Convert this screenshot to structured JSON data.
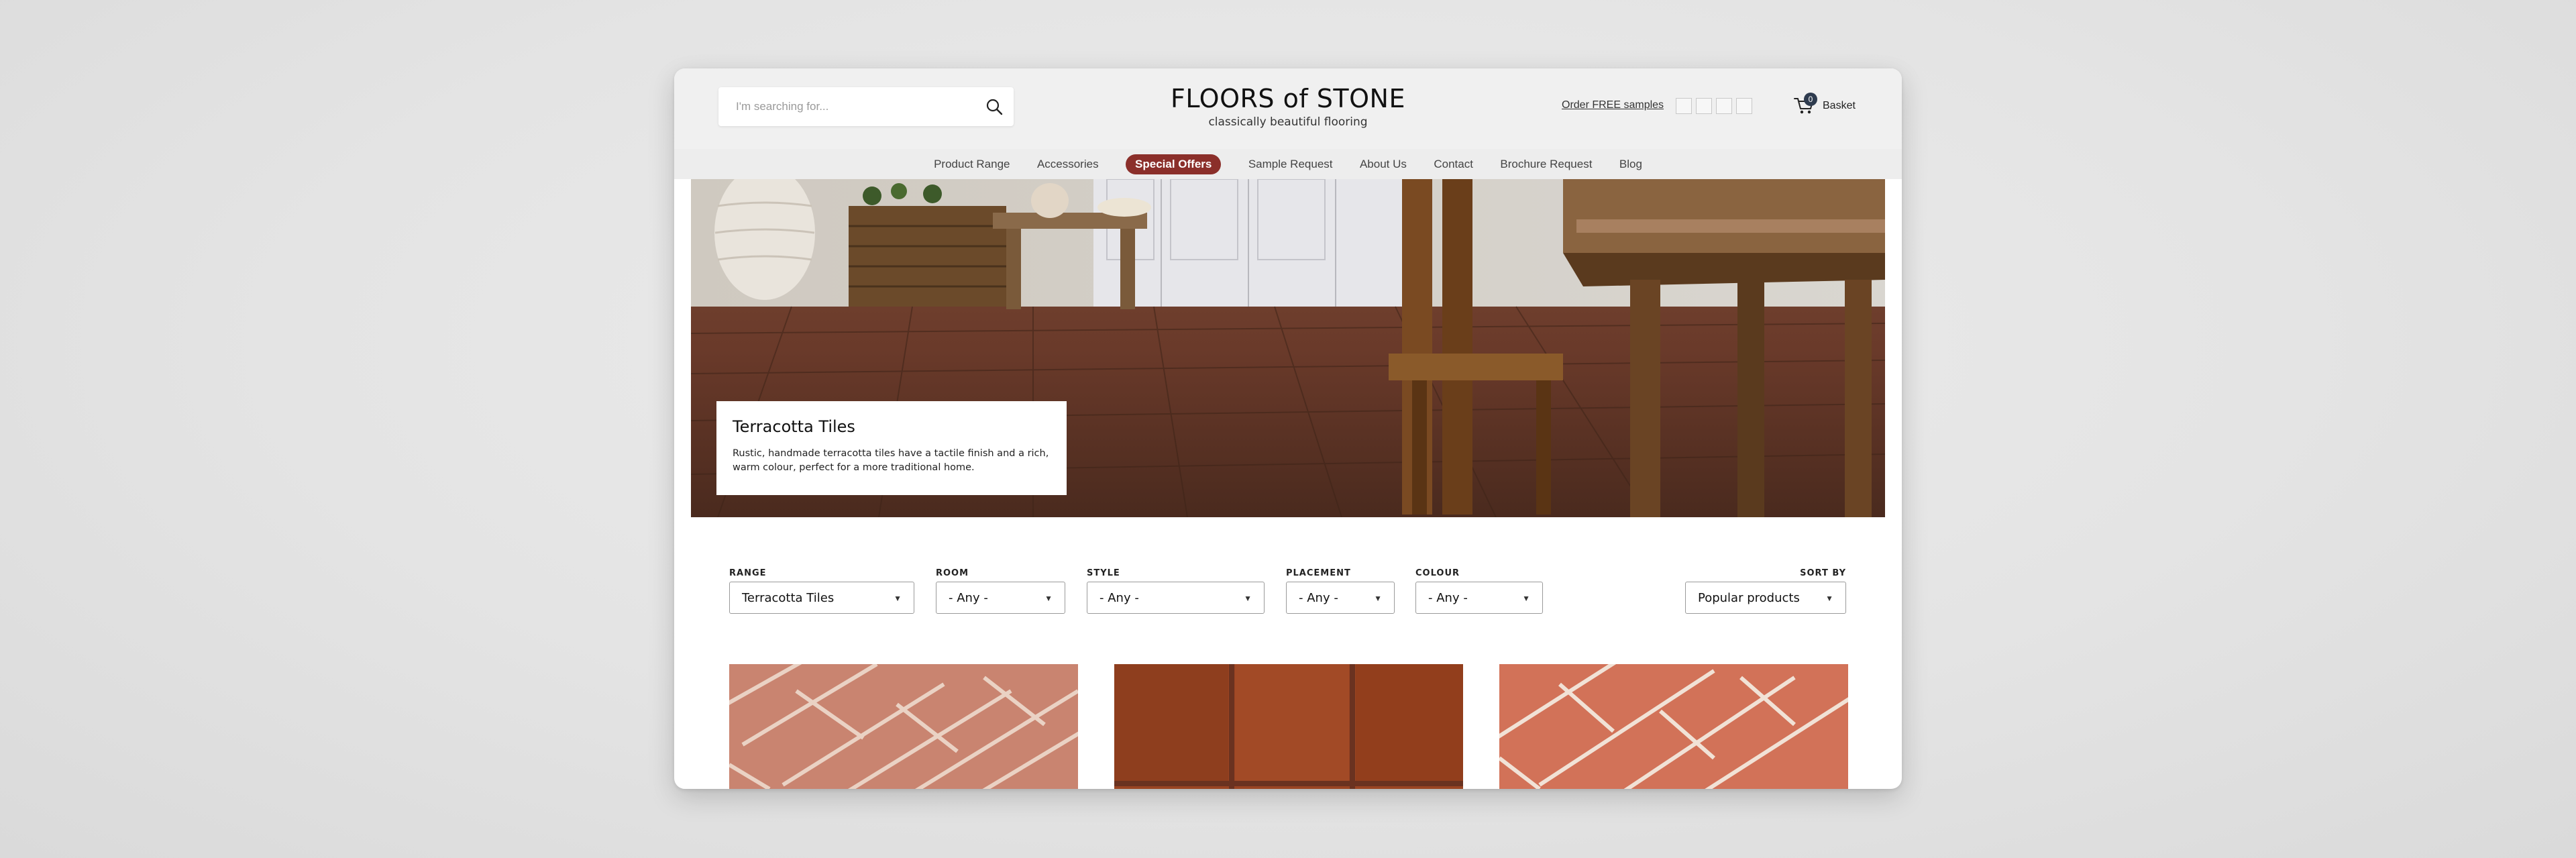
{
  "header": {
    "search_placeholder": "I'm searching for...",
    "logo_title": "FLOORS of STONE",
    "logo_tagline": "classically beautiful flooring",
    "samples_link": "Order FREE samples",
    "basket_count": "0",
    "basket_label": "Basket"
  },
  "nav": {
    "items": [
      "Product Range",
      "Accessories",
      "Special Offers",
      "Sample Request",
      "About Us",
      "Contact",
      "Brochure Request",
      "Blog"
    ]
  },
  "hero": {
    "title": "Terracotta Tiles",
    "description": "Rustic, handmade terracotta tiles have a tactile finish and a rich, warm colour, perfect for a more traditional home."
  },
  "filters": {
    "range": {
      "label": "RANGE",
      "value": "Terracotta Tiles"
    },
    "room": {
      "label": "ROOM",
      "value": "- Any -"
    },
    "style": {
      "label": "STYLE",
      "value": "- Any -"
    },
    "placement": {
      "label": "PLACEMENT",
      "value": "- Any -"
    },
    "colour": {
      "label": "COLOUR",
      "value": "- Any -"
    },
    "sort": {
      "label": "SORT BY",
      "value": "Popular products"
    }
  },
  "colors": {
    "special_offer_bg": "#8b2f2a",
    "basket_badge": "#2e3b4e",
    "header_bg": "#f0f0f0"
  }
}
